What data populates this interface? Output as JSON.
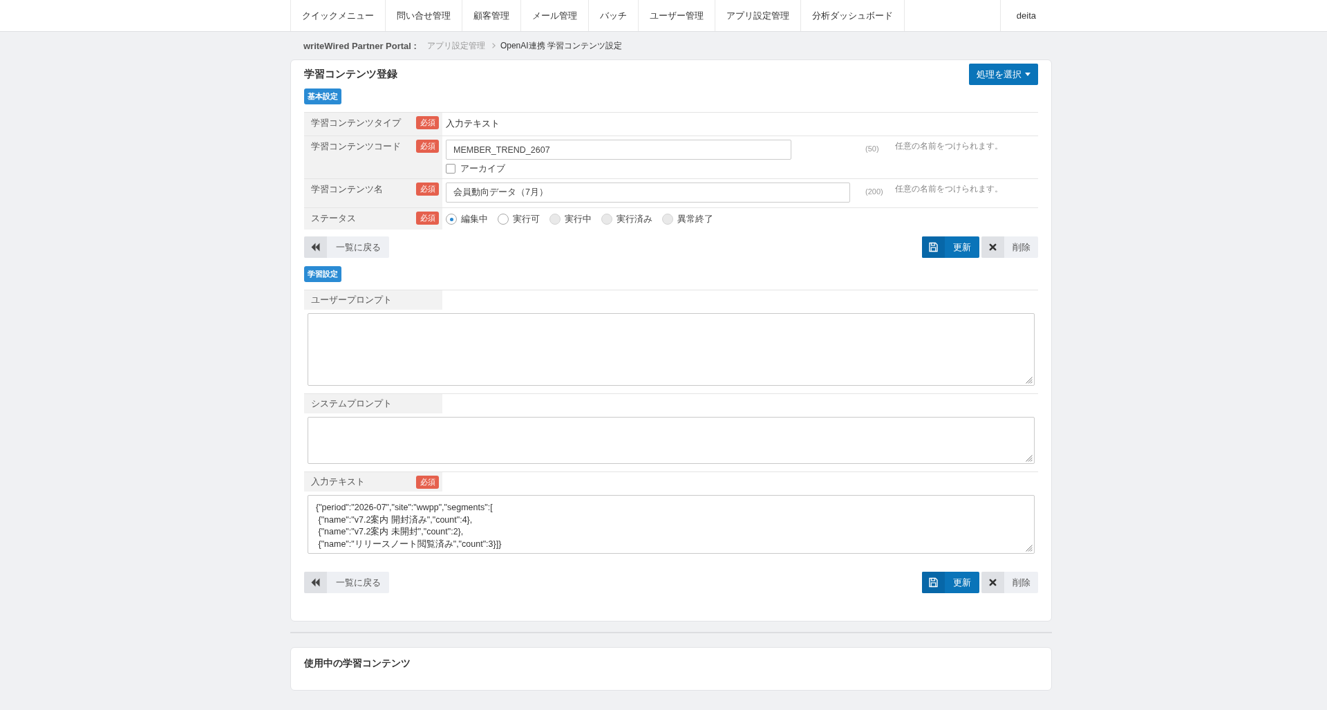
{
  "nav": {
    "items": [
      "クイックメニュー",
      "問い合せ管理",
      "顧客管理",
      "メール管理",
      "バッチ",
      "ユーザー管理",
      "アプリ設定管理",
      "分析ダッシュボード"
    ],
    "user": "deita"
  },
  "breadcrumb": {
    "portal": "writeWired Partner Portal :",
    "items": [
      "アプリ設定管理",
      "OpenAI連携 学習コンテンツ設定"
    ]
  },
  "editor": {
    "title": "学習コンテンツ登録",
    "action_button": "処理を選択",
    "basic_settings": {
      "badge": "基本設定",
      "rows": [
        {
          "kind": "text",
          "label": "学習コンテンツタイプ",
          "badge": "必須",
          "value": "入力テキスト"
        },
        {
          "kind": "input",
          "label": "学習コンテンツコード",
          "badge": "必須",
          "value": "MEMBER_TREND_2607",
          "max_length": "(50)",
          "hint": "任意の名前をつけられます。",
          "checkbox": {
            "label": "アーカイブ",
            "checked": false
          }
        },
        {
          "kind": "input",
          "label": "学習コンテンツ名",
          "badge": "必須",
          "value": "会員動向データ（7月）",
          "max_length": "(200)",
          "hint": "任意の名前をつけられます。"
        },
        {
          "kind": "radio",
          "label": "ステータス",
          "badge": "必須",
          "options": [
            {
              "label": "編集中",
              "selected": true,
              "disabled": false
            },
            {
              "label": "実行可",
              "selected": false,
              "disabled": false
            },
            {
              "label": "実行中",
              "selected": false,
              "disabled": true
            },
            {
              "label": "実行済み",
              "selected": false,
              "disabled": true
            },
            {
              "label": "異常終了",
              "selected": false,
              "disabled": true
            }
          ]
        }
      ],
      "buttons": [
        {
          "kind": "back",
          "label": "一覧に戻る"
        },
        {
          "kind": "update",
          "label": "更新"
        },
        {
          "kind": "delete",
          "label": "削除"
        }
      ]
    },
    "learning_settings": {
      "badge": "学習設定",
      "fields": [
        {
          "label": "ユーザープロンプト"
        },
        {
          "label": "システムプロンプト"
        },
        {
          "label": "入力テキスト",
          "badge": "必須",
          "value": "{\"period\":\"2026-07\",\"site\":\"wwpp\",\"segments\":[\n {\"name\":\"v7.2案内 開封済み\",\"count\":4},\n {\"name\":\"v7.2案内 未開封\",\"count\":2},\n {\"name\":\"リリースノート閲覧済み\",\"count\":3}]}"
        }
      ],
      "buttons": [
        {
          "kind": "back",
          "label": "一覧に戻る"
        },
        {
          "kind": "update",
          "label": "更新"
        },
        {
          "kind": "delete",
          "label": "削除"
        }
      ]
    }
  },
  "in_use": {
    "title": "使用中の学習コンテンツ"
  }
}
